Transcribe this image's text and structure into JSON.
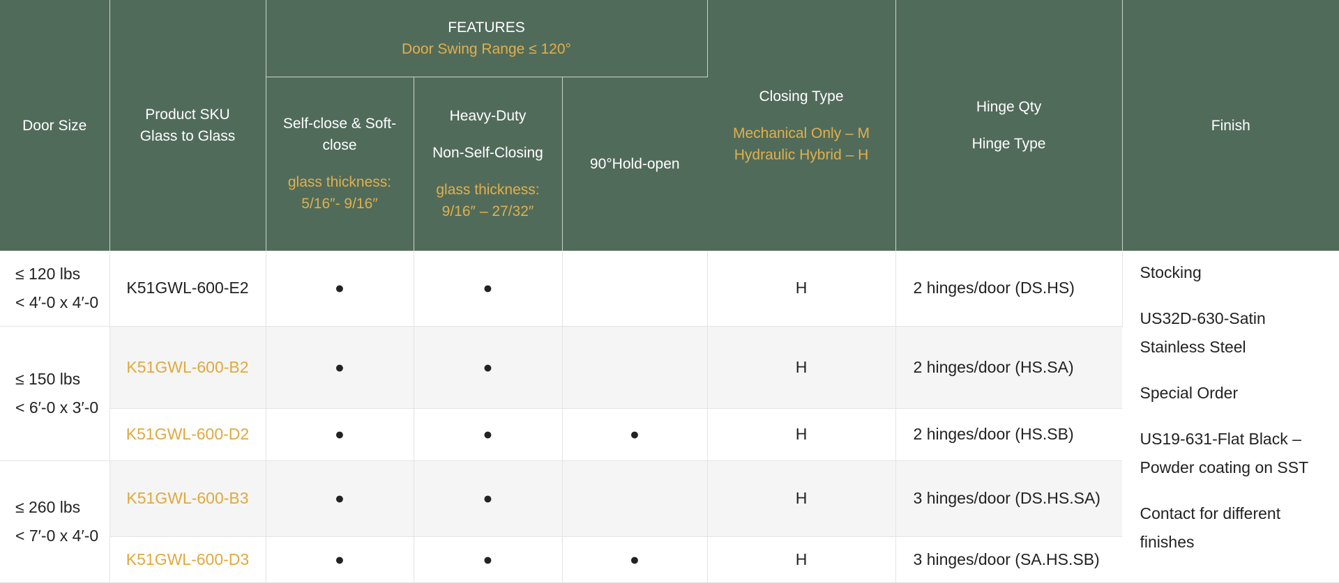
{
  "headers": {
    "door_size": "Door Size",
    "product_sku_line1": "Product SKU",
    "product_sku_line2": "Glass to Glass",
    "features": "FEATURES",
    "features_sub": "Door Swing Range ≤ 120°",
    "self_close_line1": "Self-close & Soft-",
    "self_close_line2": "close",
    "self_close_thickness_line1": "glass thickness:",
    "self_close_thickness_line2": "5/16″- 9/16″",
    "heavy_duty": "Heavy-Duty",
    "non_self_closing": "Non-Self-Closing",
    "heavy_duty_thickness_line1": "glass thickness:",
    "heavy_duty_thickness_line2": "9/16″ – 27/32″",
    "hold_open": "90°Hold-open",
    "closing_type": "Closing Type",
    "closing_mechanical": "Mechanical Only – M",
    "closing_hydraulic": "Hydraulic Hybrid – H",
    "hinge_qty": "Hinge Qty",
    "hinge_type": "Hinge Type",
    "finish": "Finish"
  },
  "size_groups": [
    {
      "weight": "≤ 120 lbs",
      "dimensions": "< 4′-0 x 4′-0"
    },
    {
      "weight": "≤ 150 lbs",
      "dimensions": "< 6′-0 x 3′-0"
    },
    {
      "weight": "≤ 260 lbs",
      "dimensions": "< 7′-0 x 4′-0"
    }
  ],
  "rows": [
    {
      "sku": "K51GWL-600-E2",
      "self_close": "●",
      "heavy_duty": "●",
      "hold_open": "",
      "closing": "H",
      "hinge": "2 hinges/door (DS.HS)"
    },
    {
      "sku": "K51GWL-600-B2",
      "self_close": "●",
      "heavy_duty": "●",
      "hold_open": "",
      "closing": "H",
      "hinge": "2 hinges/door (HS.SA)"
    },
    {
      "sku": "K51GWL-600-D2",
      "self_close": "●",
      "heavy_duty": "●",
      "hold_open": "●",
      "closing": "H",
      "hinge": "2 hinges/door (HS.SB)"
    },
    {
      "sku": "K51GWL-600-B3",
      "self_close": "●",
      "heavy_duty": "●",
      "hold_open": "",
      "closing": "H",
      "hinge": "3 hinges/door (DS.HS.SA)"
    },
    {
      "sku": "K51GWL-600-D3",
      "self_close": "●",
      "heavy_duty": "●",
      "hold_open": "●",
      "closing": "H",
      "hinge": "3 hinges/door (SA.HS.SB)"
    }
  ],
  "finish": [
    "Stocking",
    "US32D-630-Satin Stainless Steel",
    "Special Order",
    "US19-631-Flat Black – Powder coating on SST",
    "Contact for different finishes"
  ],
  "colors": {
    "header_bg": "#516b5b",
    "accent_gold": "#e1b04a",
    "row_shade": "#f5f5f5"
  }
}
